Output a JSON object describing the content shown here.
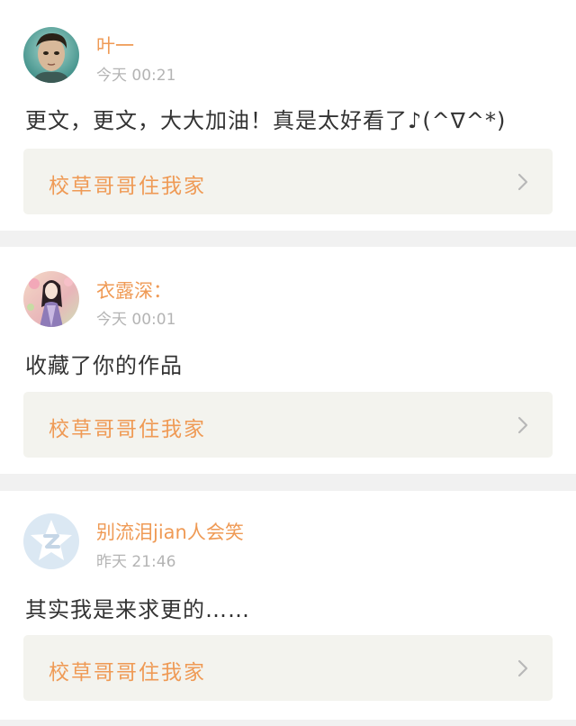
{
  "comments": [
    {
      "username": "叶一",
      "time": "今天 00:21",
      "text": "更文，更文，大大加油！真是太好看了♪(^∇^*)",
      "work_title": "校草哥哥住我家",
      "avatar_icon": "user-photo-avatar"
    },
    {
      "username": "衣露深：",
      "time": "今天 00:01",
      "text": "收藏了你的作品",
      "work_title": "校草哥哥住我家",
      "avatar_icon": "illustrated-girl-avatar"
    },
    {
      "username": "别流泪jian人会笑",
      "time": "昨天 21:46",
      "text": "其实我是来求更的……",
      "work_title": "校草哥哥住我家",
      "avatar_icon": "qzone-star-avatar"
    }
  ],
  "colors": {
    "accent": "#ef9a55",
    "meta": "#b4b4b4",
    "link_bg": "#f3f3ee",
    "divider": "#f1f1f1"
  }
}
